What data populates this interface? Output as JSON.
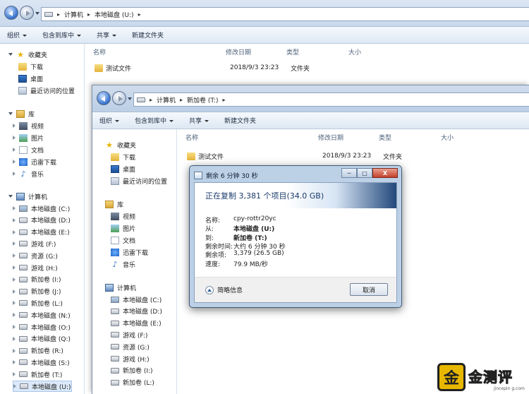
{
  "explorer_back": {
    "path": [
      "计算机",
      "本地磁盘 (U:)"
    ],
    "toolbar": [
      "组织",
      "包含到库中",
      "共享",
      "新建文件夹"
    ],
    "columns": [
      "名称",
      "修改日期",
      "类型",
      "大小"
    ],
    "files": [
      {
        "name": "测试文件",
        "date": "2018/9/3 23:23",
        "type": "文件夹"
      }
    ],
    "favorites_label": "收藏夹",
    "favorites": [
      "下载",
      "桌面",
      "最近访问的位置"
    ],
    "library_label": "库",
    "libraries": [
      "视频",
      "图片",
      "文档",
      "迅雷下载",
      "音乐"
    ],
    "computer_label": "计算机",
    "drives": [
      "本地磁盘 (C:)",
      "本地磁盘 (D:)",
      "本地磁盘 (E:)",
      "游戏 (F:)",
      "资源 (G:)",
      "游戏 (H:)",
      "新加卷 (I:)",
      "新加卷 (J:)",
      "新加卷 (L:)",
      "本地磁盘 (N:)",
      "本地磁盘 (O:)",
      "本地磁盘 (Q:)",
      "新加卷 (R:)",
      "本地磁盘 (S:)",
      "新加卷 (T:)",
      "本地磁盘 (U:)"
    ]
  },
  "explorer_front": {
    "path": [
      "计算机",
      "新加卷 (T:)"
    ],
    "toolbar": [
      "组织",
      "包含到库中",
      "共享",
      "新建文件夹"
    ],
    "columns": [
      "名称",
      "修改日期",
      "类型",
      "大小"
    ],
    "files": [
      {
        "name": "测试文件",
        "date": "2018/9/3 23:23",
        "type": "文件夹"
      }
    ],
    "favorites_label": "收藏夹",
    "favorites": [
      "下载",
      "桌面",
      "最近访问的位置"
    ],
    "library_label": "库",
    "libraries": [
      "视频",
      "图片",
      "文档",
      "迅雷下载",
      "音乐"
    ],
    "computer_label": "计算机",
    "drives": [
      "本地磁盘 (C:)",
      "本地磁盘 (D:)",
      "本地磁盘 (E:)",
      "游戏 (F:)",
      "资源 (G:)",
      "游戏 (H:)",
      "新加卷 (I:)",
      "新加卷 (L:)"
    ]
  },
  "copy_dialog": {
    "title": "剩余 6 分钟 30 秒",
    "heading": "正在复制 3,381 个项目(34.0 GB)",
    "fields": [
      {
        "key": "名称:",
        "value": "cpy-rottr20yc",
        "bold": false
      },
      {
        "key": "从:",
        "value": "本地磁盘 (U:)",
        "bold": true
      },
      {
        "key": "到:",
        "value": "新加卷 (T:)",
        "bold": true
      },
      {
        "key": "剩余时间:",
        "value": "大约 6 分钟 30 秒",
        "bold": false
      },
      {
        "key": "剩余项:",
        "value": "3,379 (26.5 GB)",
        "bold": false
      },
      {
        "key": "速度:",
        "value": "79.9 MB/秒",
        "bold": false
      }
    ],
    "progress": 0.22,
    "more_info": "简略信息",
    "cancel": "取消",
    "minimize": "─",
    "maximize": "□",
    "close": "X"
  },
  "watermark": {
    "text": "金测评",
    "badge": "金",
    "url": "jincepin g.com"
  }
}
